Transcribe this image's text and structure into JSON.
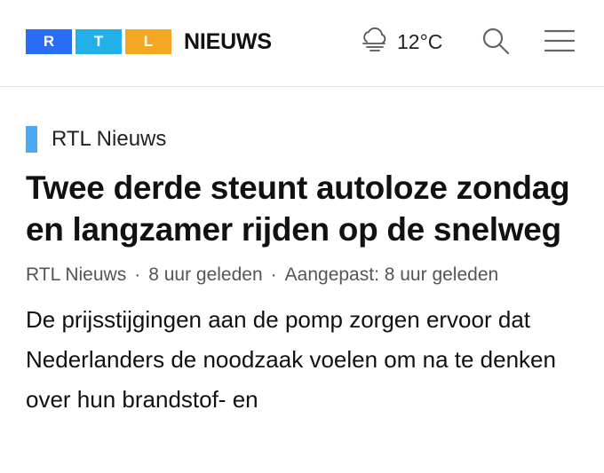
{
  "header": {
    "logo": {
      "letters": [
        "R",
        "T",
        "L"
      ],
      "word": "NIEUWS"
    },
    "weather": {
      "icon": "cloud-fog-icon",
      "temperature": "12°C"
    },
    "search_icon": "search-icon",
    "menu_icon": "hamburger-menu-icon"
  },
  "colors": {
    "logo_r": "#2a6df4",
    "logo_t": "#21b0e8",
    "logo_l": "#f5a623",
    "source_bar": "#4aa8f5"
  },
  "article": {
    "source": "RTL Nieuws",
    "headline": "Twee derde steunt autoloze zondag en langzamer rijden op de snelweg",
    "meta": {
      "author": "RTL Nieuws",
      "published": "8 uur geleden",
      "updated": "Aangepast: 8 uur geleden",
      "separator": "·"
    },
    "body": "De prijsstijgingen aan de pomp zorgen ervoor dat Nederlanders de noodzaak voelen om na te denken over hun brandstof- en"
  }
}
